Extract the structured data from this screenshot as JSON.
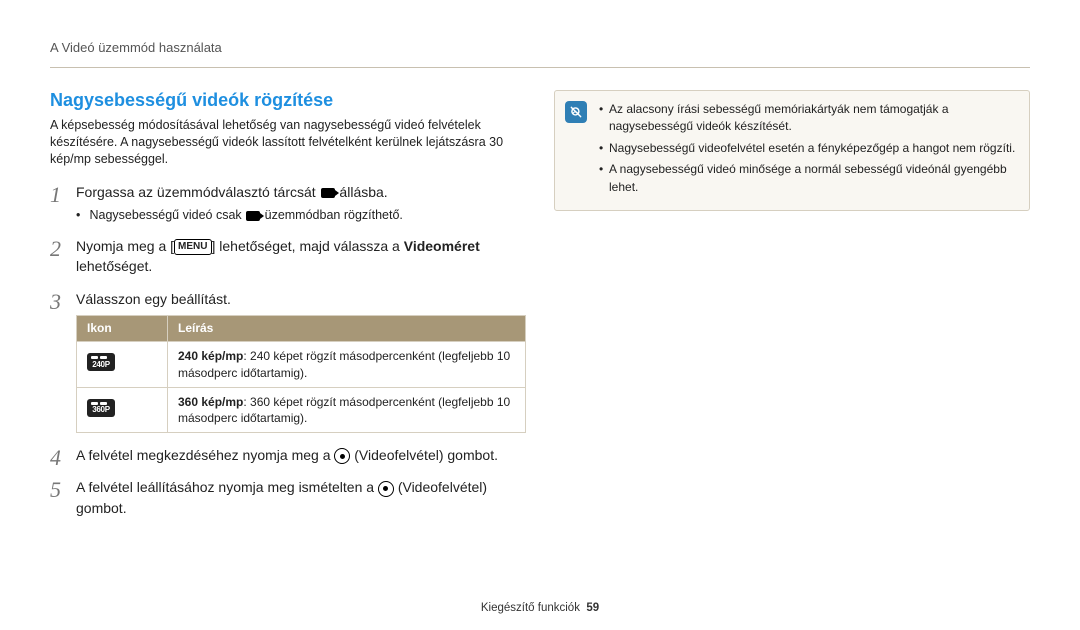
{
  "breadcrumb": "A Videó üzemmód használata",
  "heading": "Nagysebességű videók rögzítése",
  "intro": "A képsebesség módosításával lehetőség van nagysebességű videó felvételek készítésére. A nagysebességű videók lassított felvételként kerülnek lejátszásra 30 kép/mp sebességgel.",
  "steps": {
    "s1_a": "Forgassa az üzemmódválasztó tárcsát ",
    "s1_b": " állásba.",
    "s1_sub_a": "Nagysebességű videó csak ",
    "s1_sub_b": " üzemmódban rögzíthető.",
    "s2_a": "Nyomja meg a [",
    "s2_menu": "MENU",
    "s2_b": "] lehetőséget, majd válassza a ",
    "s2_bold": "Videoméret",
    "s2_c": " lehetőséget.",
    "s3": "Válasszon egy beállítást.",
    "s4_a": "A felvétel megkezdéséhez nyomja meg a ",
    "s4_b": " (Videofelvétel) gombot.",
    "s5_a": "A felvétel leállításához nyomja meg ismételten a ",
    "s5_b": " (Videofelvétel) gombot."
  },
  "table": {
    "h1": "Ikon",
    "h2": "Leírás",
    "r1_icon": "240P",
    "r1_bold": "240 kép/mp",
    "r1_rest": ": 240 képet rögzít másodpercenként (legfeljebb 10 másodperc időtartamig).",
    "r2_icon": "360P",
    "r2_bold": "360 kép/mp",
    "r2_rest": ": 360 képet rögzít másodpercenként (legfeljebb 10 másodperc időtartamig)."
  },
  "notes": {
    "n1": "Az alacsony írási sebességű memóriakártyák nem támogatják a nagysebességű videók készítését.",
    "n2": "Nagysebességű videofelvétel esetén a fényképezőgép a hangot nem rögzíti.",
    "n3": "A nagysebességű videó minősége a normál sebességű videónál gyengébb lehet."
  },
  "footer_label": "Kiegészítő funkciók",
  "footer_page": "59"
}
